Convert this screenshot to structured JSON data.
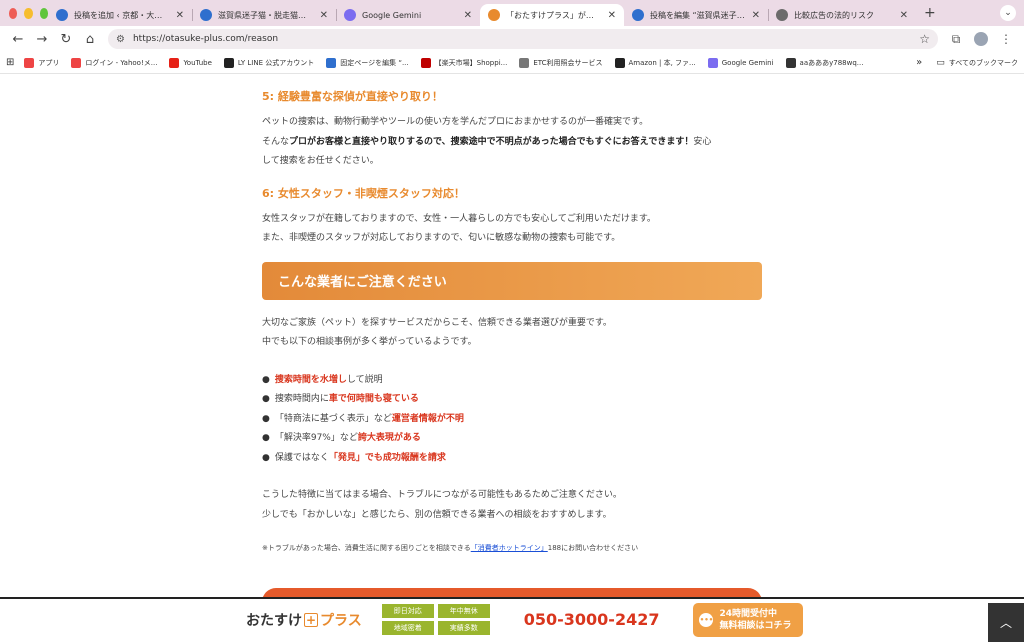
{
  "browser": {
    "tabs": [
      {
        "title": "投稿を追加 ‹ 京都・大阪・滋賀 |",
        "fav_color": "#2f6fce"
      },
      {
        "title": "滋賀県迷子猫・脱走猫ない保護率",
        "fav_color": "#2f6fce"
      },
      {
        "title": "Google Gemini",
        "fav_color": "#7b6cf0"
      },
      {
        "title": "「おたすけプラス」が選ばれる理由",
        "fav_color": "#e88a2e",
        "active": true
      },
      {
        "title": "投稿を編集 “滋賀県迷子猫・脱走",
        "fav_color": "#2f6fce"
      },
      {
        "title": "比較広告の法的リスク",
        "fav_color": "#6b6b6b"
      }
    ],
    "new_tab": "+",
    "url": "https://otasuke-plus.com/reason",
    "bookmarks": [
      {
        "label": "アプリ",
        "color": "#e44"
      },
      {
        "label": "ログイン - Yahoo!メ...",
        "color": "#e44"
      },
      {
        "label": "YouTube",
        "color": "#e62117"
      },
      {
        "label": "LY  LINE 公式アカウント",
        "color": "#222"
      },
      {
        "label": "固定ページを編集 “...",
        "color": "#2f6fce"
      },
      {
        "label": "【楽天市場】Shoppi...",
        "color": "#bf0000"
      },
      {
        "label": "ETC利用照会サービス",
        "color": "#777"
      },
      {
        "label": "Amazon | 本, ファ...",
        "color": "#222"
      },
      {
        "label": "Google Gemini",
        "color": "#7b6cf0"
      },
      {
        "label": "aaあああy788wq...",
        "color": "#333"
      }
    ],
    "bookmarks_more": "»",
    "all_bookmarks": "すべてのブックマーク"
  },
  "section5": {
    "heading": "5: 経験豊富な探偵が直接やり取り！",
    "line1": "ペットの捜索は、動物行動学やツールの使い方を学んだプロにおまかせするのが一番確実です。",
    "line2_pre": "そんな",
    "line2_b1": "プロがお客様と直接やり取りするので、捜索途中で不明点があった場合でもすぐにお答えできます！",
    "line2_post": "安心",
    "line3": "して捜索をお任せください。"
  },
  "section6": {
    "heading": "6: 女性スタッフ・非喫煙スタッフ対応！",
    "line1": "女性スタッフが在籍しておりますので、女性・一人暮らしの方でも安心してご利用いただけます。",
    "line2": "また、非喫煙のスタッフが対応しておりますので、匂いに敏感な動物の捜索も可能です。"
  },
  "caution": {
    "banner": "こんな業者にご注意ください",
    "intro1": "大切なご家族（ペット）を探すサービスだからこそ、信頼できる業者選びが重要です。",
    "intro2": "中でも以下の相談事例が多く挙がっているようです。",
    "items": [
      {
        "pre": "",
        "red": "捜索時間を水増し",
        "post": "して説明"
      },
      {
        "pre": "捜索時間内に",
        "red": "車で何時間も寝ている",
        "post": ""
      },
      {
        "pre": "「特商法に基づく表示」など",
        "red": "運営者情報が不明",
        "post": ""
      },
      {
        "pre": "「解決率97%」など",
        "red": "誇大表現がある",
        "post": ""
      },
      {
        "pre": "保護ではなく",
        "red": "「発見」でも成功報酬を請求",
        "post": ""
      }
    ],
    "outro1": "こうした特徴に当てはまる場合、トラブルにつながる可能性もあるためご注意ください。",
    "outro2": "少しでも「おかしいな」と感じたら、別の信頼できる業者への相談をおすすめします。",
    "note_pre": "※トラブルがあった場合、消費生活に関する困りごとを相談できる",
    "note_link": "「消費者ホットライン」",
    "note_post": "188にお問い合わせください"
  },
  "footer": {
    "logo_a": "おたすけ",
    "logo_b": "プラス",
    "badges": [
      "即日対応",
      "年中無休",
      "地域密着",
      "実績多数"
    ],
    "phone": "050-3000-2427",
    "cta_line1": "24時間受付中",
    "cta_line2": "無料相談はコチラ"
  },
  "colors": {
    "accent": "#e88a2e",
    "warning_red": "#d9361e",
    "badge_green": "#9ab52e"
  }
}
